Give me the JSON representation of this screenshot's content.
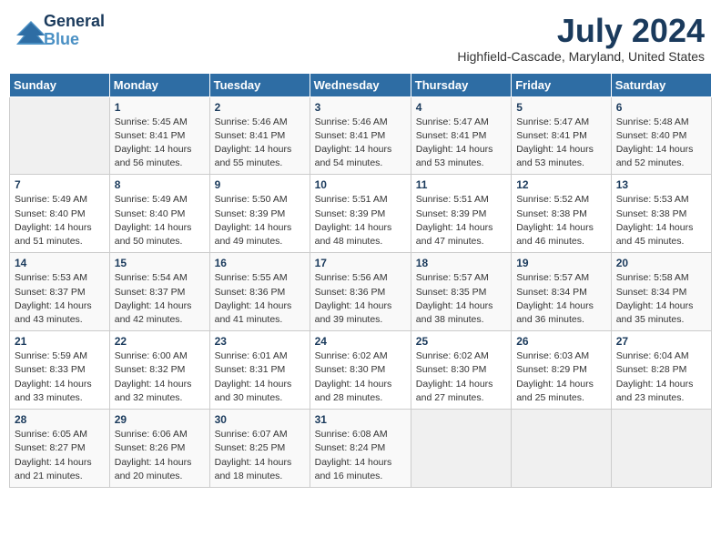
{
  "logo": {
    "line1": "General",
    "line2": "Blue"
  },
  "title": "July 2024",
  "location": "Highfield-Cascade, Maryland, United States",
  "days_header": [
    "Sunday",
    "Monday",
    "Tuesday",
    "Wednesday",
    "Thursday",
    "Friday",
    "Saturday"
  ],
  "weeks": [
    [
      {
        "day": "",
        "content": ""
      },
      {
        "day": "1",
        "content": "Sunrise: 5:45 AM\nSunset: 8:41 PM\nDaylight: 14 hours\nand 56 minutes."
      },
      {
        "day": "2",
        "content": "Sunrise: 5:46 AM\nSunset: 8:41 PM\nDaylight: 14 hours\nand 55 minutes."
      },
      {
        "day": "3",
        "content": "Sunrise: 5:46 AM\nSunset: 8:41 PM\nDaylight: 14 hours\nand 54 minutes."
      },
      {
        "day": "4",
        "content": "Sunrise: 5:47 AM\nSunset: 8:41 PM\nDaylight: 14 hours\nand 53 minutes."
      },
      {
        "day": "5",
        "content": "Sunrise: 5:47 AM\nSunset: 8:41 PM\nDaylight: 14 hours\nand 53 minutes."
      },
      {
        "day": "6",
        "content": "Sunrise: 5:48 AM\nSunset: 8:40 PM\nDaylight: 14 hours\nand 52 minutes."
      }
    ],
    [
      {
        "day": "7",
        "content": "Sunrise: 5:49 AM\nSunset: 8:40 PM\nDaylight: 14 hours\nand 51 minutes."
      },
      {
        "day": "8",
        "content": "Sunrise: 5:49 AM\nSunset: 8:40 PM\nDaylight: 14 hours\nand 50 minutes."
      },
      {
        "day": "9",
        "content": "Sunrise: 5:50 AM\nSunset: 8:39 PM\nDaylight: 14 hours\nand 49 minutes."
      },
      {
        "day": "10",
        "content": "Sunrise: 5:51 AM\nSunset: 8:39 PM\nDaylight: 14 hours\nand 48 minutes."
      },
      {
        "day": "11",
        "content": "Sunrise: 5:51 AM\nSunset: 8:39 PM\nDaylight: 14 hours\nand 47 minutes."
      },
      {
        "day": "12",
        "content": "Sunrise: 5:52 AM\nSunset: 8:38 PM\nDaylight: 14 hours\nand 46 minutes."
      },
      {
        "day": "13",
        "content": "Sunrise: 5:53 AM\nSunset: 8:38 PM\nDaylight: 14 hours\nand 45 minutes."
      }
    ],
    [
      {
        "day": "14",
        "content": "Sunrise: 5:53 AM\nSunset: 8:37 PM\nDaylight: 14 hours\nand 43 minutes."
      },
      {
        "day": "15",
        "content": "Sunrise: 5:54 AM\nSunset: 8:37 PM\nDaylight: 14 hours\nand 42 minutes."
      },
      {
        "day": "16",
        "content": "Sunrise: 5:55 AM\nSunset: 8:36 PM\nDaylight: 14 hours\nand 41 minutes."
      },
      {
        "day": "17",
        "content": "Sunrise: 5:56 AM\nSunset: 8:36 PM\nDaylight: 14 hours\nand 39 minutes."
      },
      {
        "day": "18",
        "content": "Sunrise: 5:57 AM\nSunset: 8:35 PM\nDaylight: 14 hours\nand 38 minutes."
      },
      {
        "day": "19",
        "content": "Sunrise: 5:57 AM\nSunset: 8:34 PM\nDaylight: 14 hours\nand 36 minutes."
      },
      {
        "day": "20",
        "content": "Sunrise: 5:58 AM\nSunset: 8:34 PM\nDaylight: 14 hours\nand 35 minutes."
      }
    ],
    [
      {
        "day": "21",
        "content": "Sunrise: 5:59 AM\nSunset: 8:33 PM\nDaylight: 14 hours\nand 33 minutes."
      },
      {
        "day": "22",
        "content": "Sunrise: 6:00 AM\nSunset: 8:32 PM\nDaylight: 14 hours\nand 32 minutes."
      },
      {
        "day": "23",
        "content": "Sunrise: 6:01 AM\nSunset: 8:31 PM\nDaylight: 14 hours\nand 30 minutes."
      },
      {
        "day": "24",
        "content": "Sunrise: 6:02 AM\nSunset: 8:30 PM\nDaylight: 14 hours\nand 28 minutes."
      },
      {
        "day": "25",
        "content": "Sunrise: 6:02 AM\nSunset: 8:30 PM\nDaylight: 14 hours\nand 27 minutes."
      },
      {
        "day": "26",
        "content": "Sunrise: 6:03 AM\nSunset: 8:29 PM\nDaylight: 14 hours\nand 25 minutes."
      },
      {
        "day": "27",
        "content": "Sunrise: 6:04 AM\nSunset: 8:28 PM\nDaylight: 14 hours\nand 23 minutes."
      }
    ],
    [
      {
        "day": "28",
        "content": "Sunrise: 6:05 AM\nSunset: 8:27 PM\nDaylight: 14 hours\nand 21 minutes."
      },
      {
        "day": "29",
        "content": "Sunrise: 6:06 AM\nSunset: 8:26 PM\nDaylight: 14 hours\nand 20 minutes."
      },
      {
        "day": "30",
        "content": "Sunrise: 6:07 AM\nSunset: 8:25 PM\nDaylight: 14 hours\nand 18 minutes."
      },
      {
        "day": "31",
        "content": "Sunrise: 6:08 AM\nSunset: 8:24 PM\nDaylight: 14 hours\nand 16 minutes."
      },
      {
        "day": "",
        "content": ""
      },
      {
        "day": "",
        "content": ""
      },
      {
        "day": "",
        "content": ""
      }
    ]
  ]
}
